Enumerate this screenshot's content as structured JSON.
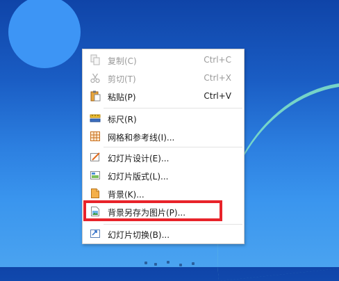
{
  "menu": {
    "items": [
      {
        "label": "复制(C)",
        "shortcut": "Ctrl+C",
        "icon": "copy-icon",
        "enabled": false
      },
      {
        "label": "剪切(T)",
        "shortcut": "Ctrl+X",
        "icon": "scissors-icon",
        "enabled": false
      },
      {
        "label": "粘贴(P)",
        "shortcut": "Ctrl+V",
        "icon": "paste-icon",
        "enabled": true
      },
      {
        "label": "标尺(R)",
        "icon": "ruler-icon",
        "enabled": true
      },
      {
        "label": "网格和参考线(I)...",
        "icon": "grid-icon",
        "enabled": true
      },
      {
        "label": "幻灯片设计(E)...",
        "icon": "slide-design-icon",
        "enabled": true
      },
      {
        "label": "幻灯片版式(L)...",
        "icon": "slide-layout-icon",
        "enabled": true
      },
      {
        "label": "背景(K)...",
        "icon": "background-icon",
        "enabled": true
      },
      {
        "label": "背景另存为图片(P)...",
        "icon": "save-background-image-icon",
        "enabled": true,
        "highlighted": true
      },
      {
        "label": "幻灯片切换(B)...",
        "icon": "slide-transition-icon",
        "enabled": true
      }
    ]
  },
  "colors": {
    "highlight_border": "#e8232a",
    "disabled_text": "#9a9a9a",
    "desktop_blue": "#1a5dc4"
  }
}
